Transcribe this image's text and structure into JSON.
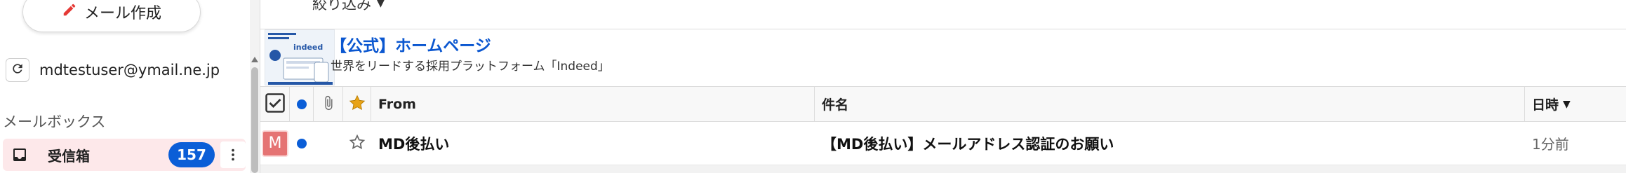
{
  "sidebar": {
    "compose_label": "メール作成",
    "account_email": "mdtestuser@ymail.ne.jp",
    "mailbox_heading": "メールボックス",
    "inbox": {
      "label": "受信箱",
      "count": "157"
    }
  },
  "toolbar": {
    "filter_label": "絞り込み"
  },
  "ad": {
    "title": "【公式】ホームページ",
    "subtitle": "世界をリードする採用プラットフォーム「Indeed」",
    "thumb_brand": "indeed"
  },
  "columns": {
    "from": "From",
    "subject": "件名",
    "date": "日時"
  },
  "messages": [
    {
      "avatar_letter": "M",
      "sender": "MD後払い",
      "subject": "【MD後払い】メールアドレス認証のお願い",
      "time": "1分前"
    }
  ],
  "colors": {
    "accent": "#0b5ed7",
    "inbox_bg": "#fde8ea",
    "avatar": "#e57373",
    "star_header": "#e8a317"
  }
}
